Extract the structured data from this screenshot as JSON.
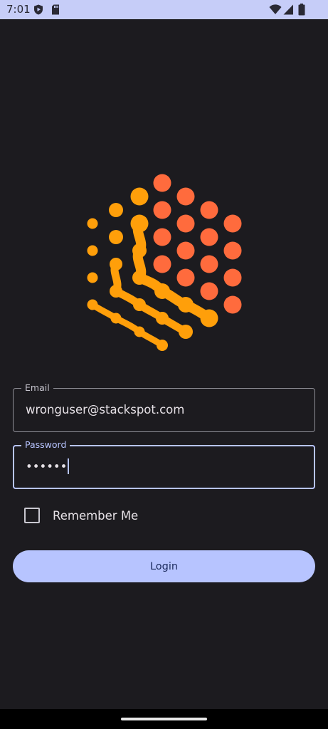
{
  "status_bar": {
    "time": "7:01",
    "left_icons": [
      "shield-play-icon",
      "sd-card-icon"
    ],
    "right_icons": [
      "wifi-icon",
      "cellular-signal-icon",
      "battery-icon"
    ]
  },
  "logo": {
    "icon": "stackspot-logo-icon",
    "colors": {
      "orange": "#ff6b3d",
      "amber": "#ff9f0a"
    }
  },
  "form": {
    "email": {
      "label": "Email",
      "value": "wronguser@stackspot.com"
    },
    "password": {
      "label": "Password",
      "value": "••••••"
    },
    "remember_me": {
      "label": "Remember Me",
      "checked": false
    },
    "login_label": "Login"
  },
  "colors": {
    "background": "#1c1b1f",
    "primary": "#b7c4ff",
    "status_bar": "#c6cdf8"
  }
}
